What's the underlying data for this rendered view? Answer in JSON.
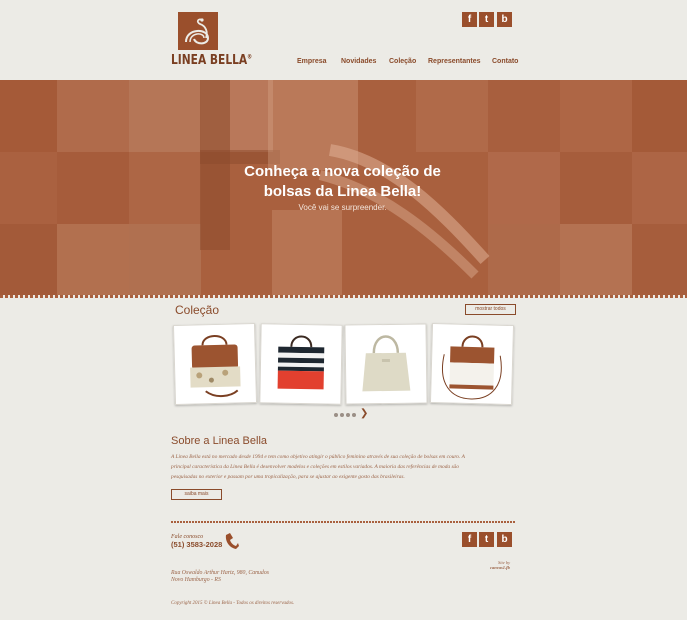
{
  "brand": {
    "logo_text": "LINEA BELLA",
    "registered": "®"
  },
  "header": {
    "social": [
      "f",
      "t",
      "b"
    ],
    "nav": [
      "Empresa",
      "Novidades",
      "Coleção",
      "Representantes",
      "Contato"
    ]
  },
  "hero": {
    "title_line1": "Conheça a nova coleção de",
    "title_line2": "bolsas da Linea Bella!",
    "subtitle": "Você vai se surpreender."
  },
  "collection": {
    "title": "Coleção",
    "show_all": "mostrar todos",
    "products": [
      {
        "icon": "floral-tote-bag-icon"
      },
      {
        "icon": "striped-bag-icon"
      },
      {
        "icon": "cream-tote-bag-icon"
      },
      {
        "icon": "white-brown-bag-icon"
      }
    ],
    "pagination_dots": 4,
    "next_icon": "chevron-right-icon"
  },
  "about": {
    "title": "Sobre a Linea Bella",
    "line1": "A Linea Bella está no mercado desde 1994 e tem como objetivo atingir o público feminino através de sua coleção de bolsas em couro. A",
    "line2": "principal característica da Linea Bella é desenvolver modelos e coleções em estilos variados. A maioria das referências de moda são",
    "line3": "pesquisadas no exterior e passam por uma tropicalização, para se ajustar ao exigente gosto das brasileiras.",
    "more_button": "saiba mais"
  },
  "footer": {
    "contact_label": "Fale conosco",
    "phone": "(51) 3583-2028",
    "address_line1": "Rua Oswaldo Arthur Hartz, 980, Canudos",
    "address_line2": "Novo Hamburgo - RS",
    "copyright": "Copyright 2015 © Linea Bella - Todos os direitos reservados.",
    "credit_line1": "Site by",
    "credit_line2": "canvas1.fb",
    "social": [
      "f",
      "t",
      "b"
    ]
  },
  "colors": {
    "brand": "#9a4f2c",
    "hero": "#a9603e",
    "background": "#ecebe6"
  }
}
